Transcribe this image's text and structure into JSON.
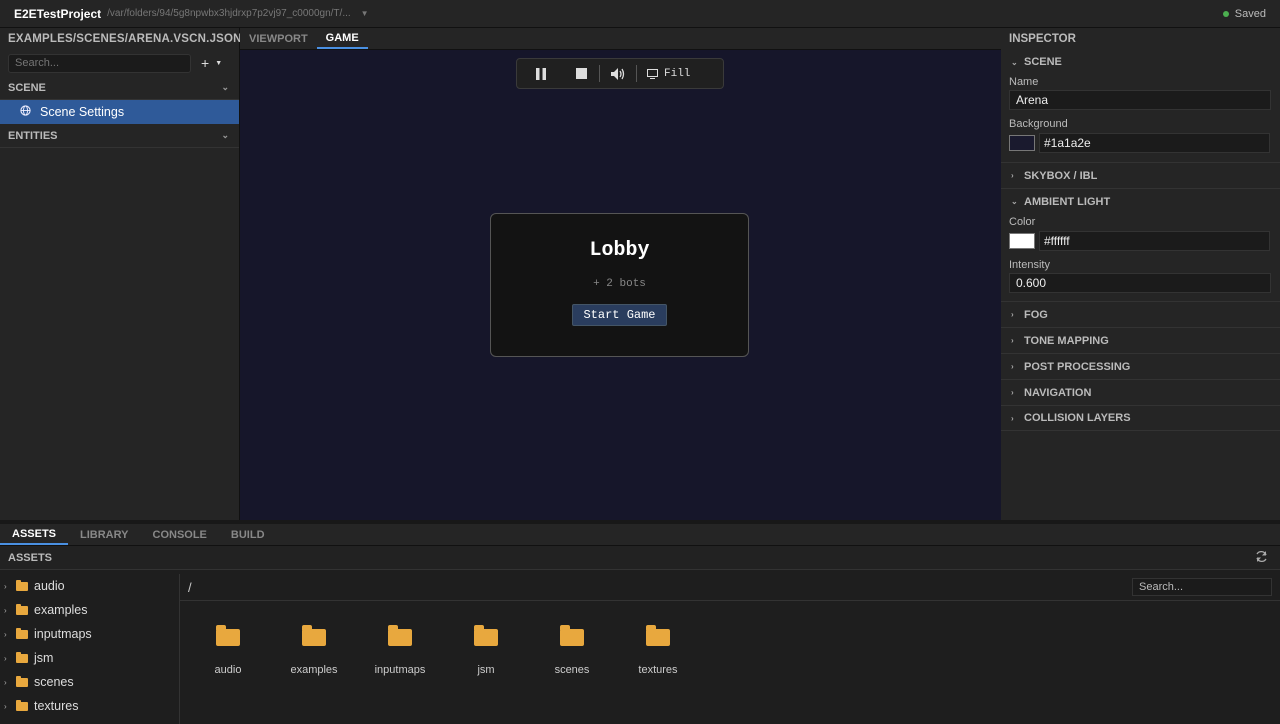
{
  "titlebar": {
    "project": "E2ETestProject",
    "path": "/var/folders/94/5g8npwbx3hjdrxp7p2vj97_c0000gn/T/...",
    "status": "Saved"
  },
  "left": {
    "header": "EXAMPLES/SCENES/ARENA.VSCN.JSON",
    "search_placeholder": "Search...",
    "add_label": "+",
    "scene_section": "SCENE",
    "scene_item": "Scene Settings",
    "entities_section": "ENTITIES"
  },
  "center": {
    "tabs": [
      {
        "label": "VIEWPORT"
      },
      {
        "label": "GAME"
      }
    ],
    "toolbar": {
      "fill_label": "Fill"
    },
    "lobby": {
      "title": "Lobby",
      "bots": "+ 2 bots",
      "start_label": "Start Game"
    }
  },
  "inspector": {
    "header": "INSPECTOR",
    "scene_section": "SCENE",
    "name_label": "Name",
    "name_value": "Arena",
    "background_label": "Background",
    "background_value": "#1a1a2e",
    "skybox_section": "SKYBOX / IBL",
    "ambient_section": "AMBIENT LIGHT",
    "color_label": "Color",
    "color_value": "#ffffff",
    "intensity_label": "Intensity",
    "intensity_value": "0.600",
    "sections": [
      "FOG",
      "TONE MAPPING",
      "POST PROCESSING",
      "NAVIGATION",
      "COLLISION LAYERS"
    ]
  },
  "bottom": {
    "tabs": [
      {
        "label": "ASSETS"
      },
      {
        "label": "LIBRARY"
      },
      {
        "label": "CONSOLE"
      },
      {
        "label": "BUILD"
      }
    ],
    "assets_header": "ASSETS",
    "path": "/",
    "search_placeholder": "Search...",
    "tree": [
      {
        "label": "audio"
      },
      {
        "label": "examples"
      },
      {
        "label": "inputmaps"
      },
      {
        "label": "jsm"
      },
      {
        "label": "scenes"
      },
      {
        "label": "textures"
      }
    ],
    "grid": [
      {
        "label": "audio"
      },
      {
        "label": "examples"
      },
      {
        "label": "inputmaps"
      },
      {
        "label": "jsm"
      },
      {
        "label": "scenes"
      },
      {
        "label": "textures"
      }
    ]
  },
  "colors": {
    "accent": "#4a90e2",
    "selection": "#2f5a99",
    "folder": "#e8a83e",
    "saved": "#4caf50",
    "game_bg": "#16162a"
  }
}
